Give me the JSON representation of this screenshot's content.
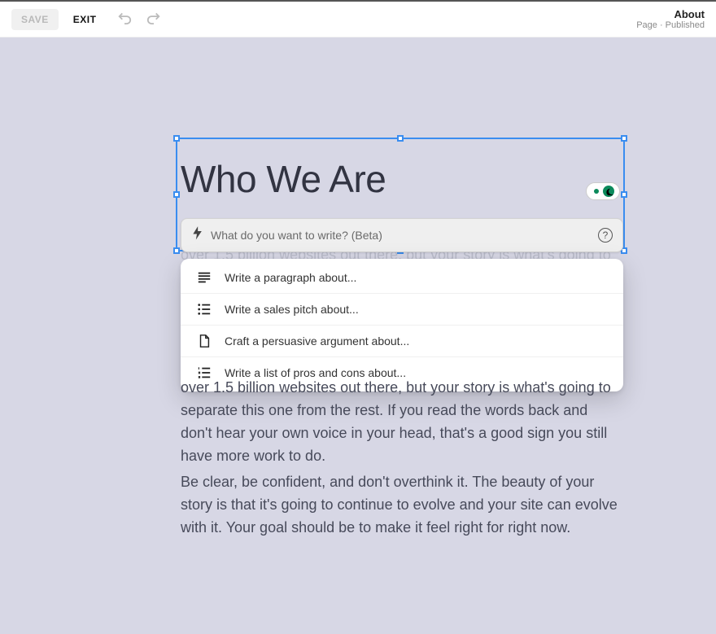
{
  "toolbar": {
    "save_label": "SAVE",
    "exit_label": "EXIT"
  },
  "status": {
    "title": "About",
    "subtitle": "Page · Published"
  },
  "editor": {
    "heading": "Who We Are",
    "obscured_text_fragment": "over 1.5 billion websites out there, but your story is what's going to",
    "para_mid": "over 1.5 billion websites out there, but your story is what's going to separate this one from the rest. If you read the words back and don't hear your own voice in your head, that's a good sign you still have more work to do.",
    "para_bottom": "Be clear, be confident, and don't overthink it. The beauty of your story is that it's going to continue to evolve and your site can evolve with it. Your goal should be to make it feel right for right now."
  },
  "assist": {
    "placeholder": "What do you want to write? (Beta)",
    "suggestions": [
      {
        "icon": "paragraph",
        "label": "Write a paragraph about..."
      },
      {
        "icon": "bullets",
        "label": "Write a sales pitch about..."
      },
      {
        "icon": "document",
        "label": "Craft a persuasive argument about..."
      },
      {
        "icon": "numbered",
        "label": "Write a list of pros and cons about..."
      }
    ]
  }
}
